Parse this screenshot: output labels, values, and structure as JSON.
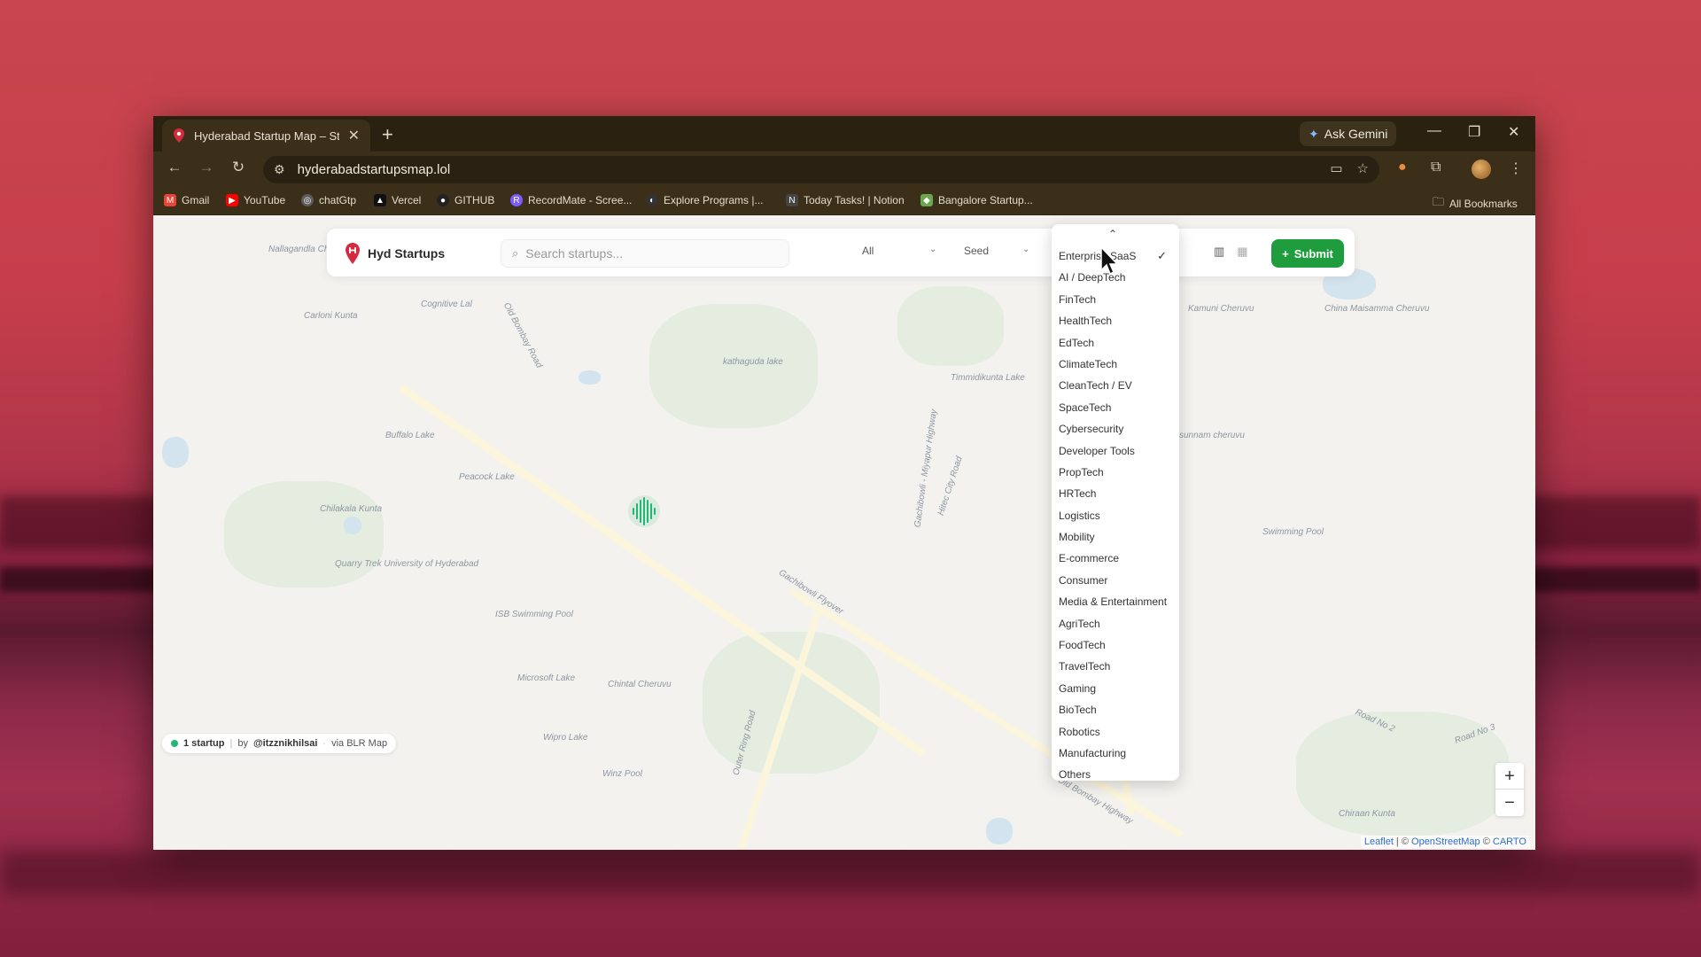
{
  "browser": {
    "tab_title": "Hyderabad Startup Map – Start",
    "new_tab": "+",
    "gemini_label": "Ask Gemini",
    "url": "hyderabadstartupsmap.lol",
    "bookmarks": [
      {
        "label": "Gmail",
        "icon": "gmail-icon",
        "color": "#ea4335"
      },
      {
        "label": "YouTube",
        "icon": "youtube-icon",
        "color": "#ff0000"
      },
      {
        "label": "chatGtp",
        "icon": "openai-icon",
        "color": "#5b5b5b"
      },
      {
        "label": "Vercel",
        "icon": "vercel-icon",
        "color": "#111111"
      },
      {
        "label": "GITHUB",
        "icon": "github-icon",
        "color": "#222222"
      },
      {
        "label": "RecordMate - Scree...",
        "icon": "recordmate-icon",
        "color": "#7c5cff"
      },
      {
        "label": "Explore Programs |...",
        "icon": "explore-icon",
        "color": "#333333"
      },
      {
        "label": "Today Tasks! | Notion",
        "icon": "notion-icon",
        "color": "#444444"
      },
      {
        "label": "Bangalore Startup...",
        "icon": "bangalore-icon",
        "color": "#6aa84f"
      }
    ],
    "all_bookmarks": "All Bookmarks"
  },
  "app": {
    "brand": "Hyd Startups",
    "brand_color": "#d62b3f",
    "search_placeholder": "Search startups...",
    "filter_all": "All",
    "filter_stage": "Seed",
    "submit_label": "Submit",
    "accent": "#1e9c3e",
    "sectors": [
      "Enterprise SaaS",
      "AI / DeepTech",
      "FinTech",
      "HealthTech",
      "EdTech",
      "ClimateTech",
      "CleanTech / EV",
      "SpaceTech",
      "Cybersecurity",
      "Developer Tools",
      "PropTech",
      "HRTech",
      "Logistics",
      "Mobility",
      "E-commerce",
      "Consumer",
      "Media & Entertainment",
      "AgriTech",
      "FoodTech",
      "TravelTech",
      "Gaming",
      "BioTech",
      "Robotics",
      "Manufacturing",
      "Others"
    ],
    "selected_sector": "Enterprise SaaS"
  },
  "map": {
    "labels": [
      "Nallagandla Cheruvu",
      "Cognitive Lal",
      "Old Bombay Road",
      "kathaguda lake",
      "Timmidikunta Lake",
      "Kamuni Cheruvu",
      "China Maisamma Cheruvu",
      "Carloni Kunta",
      "Buffalo Lake",
      "Peacock Lake",
      "Chilakala Kunta",
      "Quarry Trek University of Hyderabad",
      "ISB Swimming Pool",
      "Microsoft Lake",
      "Chintal Cheruvu",
      "Wipro Lake",
      "Winz Pool",
      "Outer Ring Road",
      "Gachibowli Flyover",
      "Old Bombay Highway",
      "Hitec City Road",
      "Gachibowli - Miyapur Highway",
      "sunnam cheruvu",
      "Swimming Pool",
      "Road No 2",
      "Road No 3",
      "Chiraan Kunta"
    ],
    "zoom_in": "+",
    "zoom_out": "−"
  },
  "footer": {
    "count": "1 startup",
    "by_prefix": "by",
    "author": "@itzznikhilsai",
    "via": "via BLR Map"
  },
  "attribution": {
    "leaflet": "Leaflet",
    "sep": " | © ",
    "osm": "OpenStreetMap",
    "carto_prefix": " © ",
    "carto": "CARTO"
  }
}
